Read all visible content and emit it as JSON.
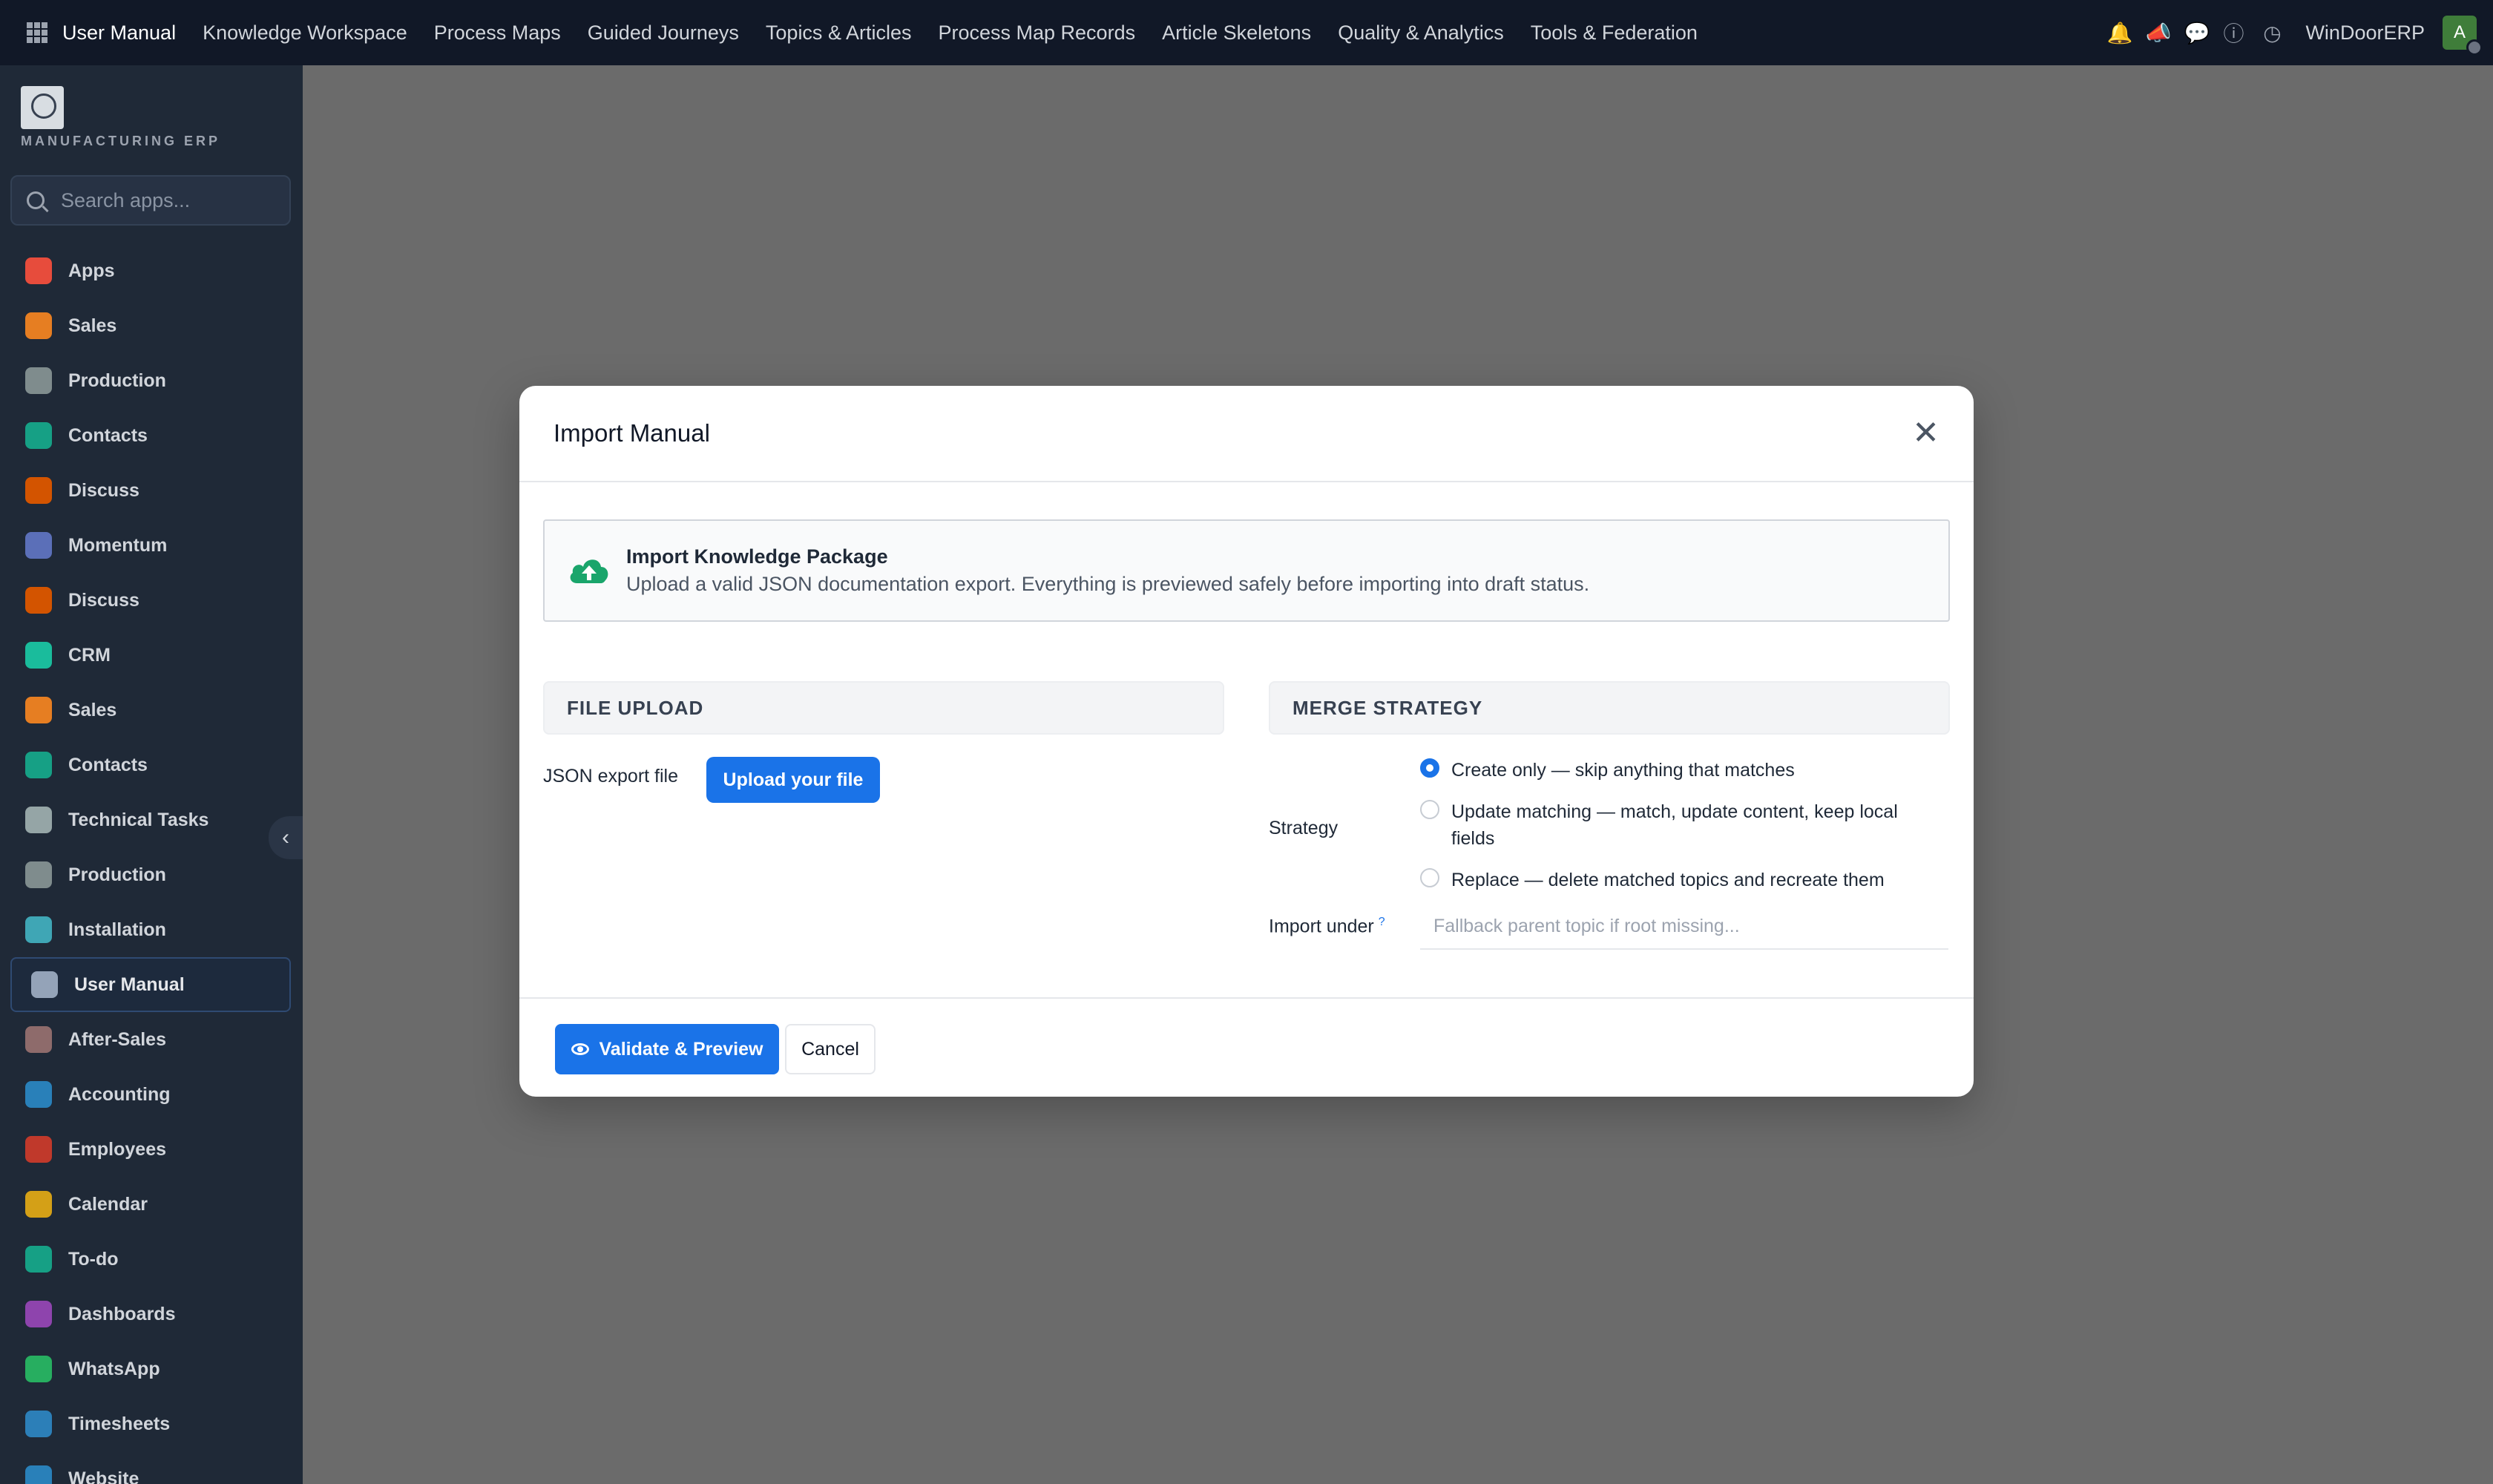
{
  "topbar": {
    "menu": [
      {
        "label": "User Manual",
        "name": "topnav-user-manual"
      },
      {
        "label": "Knowledge Workspace",
        "name": "topnav-knowledge-workspace"
      },
      {
        "label": "Process Maps",
        "name": "topnav-process-maps"
      },
      {
        "label": "Guided Journeys",
        "name": "topnav-guided-journeys"
      },
      {
        "label": "Topics & Articles",
        "name": "topnav-topics-articles"
      },
      {
        "label": "Process Map Records",
        "name": "topnav-process-map-records"
      },
      {
        "label": "Article Skeletons",
        "name": "topnav-article-skeletons"
      },
      {
        "label": "Quality & Analytics",
        "name": "topnav-quality-analytics"
      },
      {
        "label": "Tools & Federation",
        "name": "topnav-tools-federation"
      }
    ],
    "company": "WinDoorERP",
    "avatar_letter": "A"
  },
  "sidebar": {
    "logo_text": "MANUFACTURING ERP",
    "search_placeholder": "Search apps...",
    "items": [
      {
        "label": "Apps",
        "icon": "apps-icon",
        "color": "#e74c3c"
      },
      {
        "label": "Sales",
        "icon": "sales-icon",
        "color": "#e67e22"
      },
      {
        "label": "Production",
        "icon": "production-icon",
        "color": "#7f8c8d"
      },
      {
        "label": "Contacts",
        "icon": "contacts-icon",
        "color": "#16a085"
      },
      {
        "label": "Discuss",
        "icon": "discuss-icon",
        "color": "#d35400"
      },
      {
        "label": "Momentum",
        "icon": "momentum-icon",
        "color": "#5b6fb8"
      },
      {
        "label": "Discuss",
        "icon": "discuss-icon",
        "color": "#d35400"
      },
      {
        "label": "CRM",
        "icon": "crm-icon",
        "color": "#1abc9c"
      },
      {
        "label": "Sales",
        "icon": "sales-icon",
        "color": "#e67e22"
      },
      {
        "label": "Contacts",
        "icon": "contacts-icon",
        "color": "#16a085"
      },
      {
        "label": "Technical Tasks",
        "icon": "technical-tasks-icon",
        "color": "#95a5a6"
      },
      {
        "label": "Production",
        "icon": "production-icon",
        "color": "#7f8c8d"
      },
      {
        "label": "Installation",
        "icon": "installation-icon",
        "color": "#3fa6b5"
      },
      {
        "label": "User Manual",
        "icon": "user-manual-icon",
        "color": "#94a3b8",
        "active": true
      },
      {
        "label": "After-Sales",
        "icon": "after-sales-icon",
        "color": "#8e6b6b"
      },
      {
        "label": "Accounting",
        "icon": "accounting-icon",
        "color": "#2980b9"
      },
      {
        "label": "Employees",
        "icon": "employees-icon",
        "color": "#c0392b"
      },
      {
        "label": "Calendar",
        "icon": "calendar-icon",
        "color": "#d4a017"
      },
      {
        "label": "To-do",
        "icon": "todo-icon",
        "color": "#16a085"
      },
      {
        "label": "Dashboards",
        "icon": "dashboards-icon",
        "color": "#8e44ad"
      },
      {
        "label": "WhatsApp",
        "icon": "whatsapp-icon",
        "color": "#27ae60"
      },
      {
        "label": "Timesheets",
        "icon": "timesheets-icon",
        "color": "#2c7fb8"
      },
      {
        "label": "Website",
        "icon": "website-icon",
        "color": "#2980b9"
      }
    ]
  },
  "modal": {
    "title": "Import Manual",
    "info_title": "Import Knowledge Package",
    "info_sub": "Upload a valid JSON documentation export. Everything is previewed safely before importing into draft status.",
    "file_section": "FILE UPLOAD",
    "merge_section": "MERGE STRATEGY",
    "file_label": "JSON export file",
    "upload_button": "Upload your file",
    "strategy_label": "Strategy",
    "options": [
      {
        "label": "Create only — skip anything that matches",
        "checked": true
      },
      {
        "label": "Update matching — match, update content, keep local fields",
        "checked": false
      },
      {
        "label": "Replace — delete matched topics and recreate them",
        "checked": false
      }
    ],
    "import_under_label": "Import under",
    "import_under_help": "?",
    "import_under_placeholder": "Fallback parent topic if root missing...",
    "validate_button": "Validate & Preview",
    "cancel_button": "Cancel"
  },
  "colors": {
    "accent": "#1a73e8",
    "topbar": "#111827",
    "sidebar": "#1f2937",
    "backdrop": "#6b6b6b",
    "upload_icon": "#1aa56b"
  }
}
